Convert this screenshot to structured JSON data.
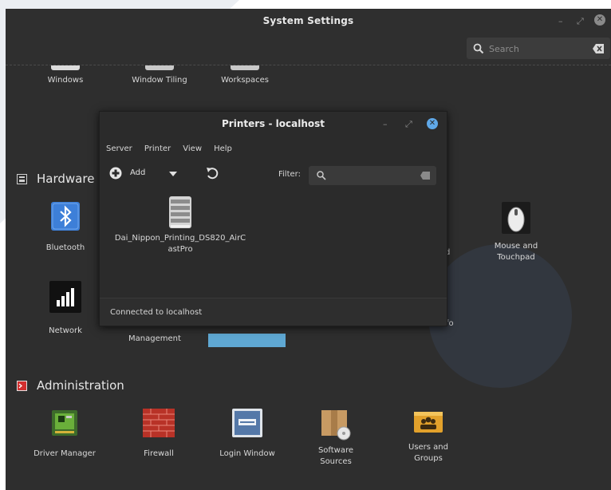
{
  "system_settings": {
    "title": "System Settings",
    "search_placeholder": "Search",
    "controls": {
      "minimize": "–",
      "maximize": "⤢",
      "close": "✕"
    },
    "top_row": [
      {
        "label": "Windows",
        "icon": "windows-icon"
      },
      {
        "label": "Window Tiling",
        "icon": "window-tiling-icon"
      },
      {
        "label": "Workspaces",
        "icon": "workspaces-icon"
      }
    ],
    "hardware": {
      "title": "Hardware",
      "items": [
        {
          "label": "Bluetooth",
          "icon": "bluetooth-icon"
        },
        {
          "label": "Mouse and Touchpad",
          "label_line1": "Mouse and",
          "label_line2": "Touchpad",
          "icon": "mouse-icon"
        },
        {
          "label": "Network",
          "icon": "network-icon"
        }
      ],
      "partial_labels": {
        "power": "Management",
        "sysinfo_tail": "fo",
        "d_tail": "d"
      }
    },
    "administration": {
      "title": "Administration",
      "items": [
        {
          "label": "Driver Manager",
          "icon": "driver-manager-icon"
        },
        {
          "label": "Firewall",
          "icon": "firewall-icon"
        },
        {
          "label": "Login Window",
          "icon": "login-window-icon"
        },
        {
          "label": "Software Sources",
          "label_line1": "Software",
          "label_line2": "Sources",
          "icon": "software-sources-icon"
        },
        {
          "label": "Users and Groups",
          "label_line1": "Users and",
          "label_line2": "Groups",
          "icon": "users-groups-icon"
        }
      ]
    }
  },
  "printers_window": {
    "title": "Printers - localhost",
    "menu": [
      "Server",
      "Printer",
      "View",
      "Help"
    ],
    "toolbar": {
      "add_label": "Add",
      "filter_label": "Filter:"
    },
    "printer": {
      "name_line1": "Dai_Nippon_Printing_DS820_AirC",
      "name_line2": "astPro"
    },
    "status": "Connected to localhost"
  },
  "colors": {
    "window_bg": "#2e2e2e",
    "accent_close": "#5fa8e8",
    "bluetooth": "#3d7fd8",
    "firewall": "#c0392b",
    "selected_item": "#5fa8d3"
  }
}
